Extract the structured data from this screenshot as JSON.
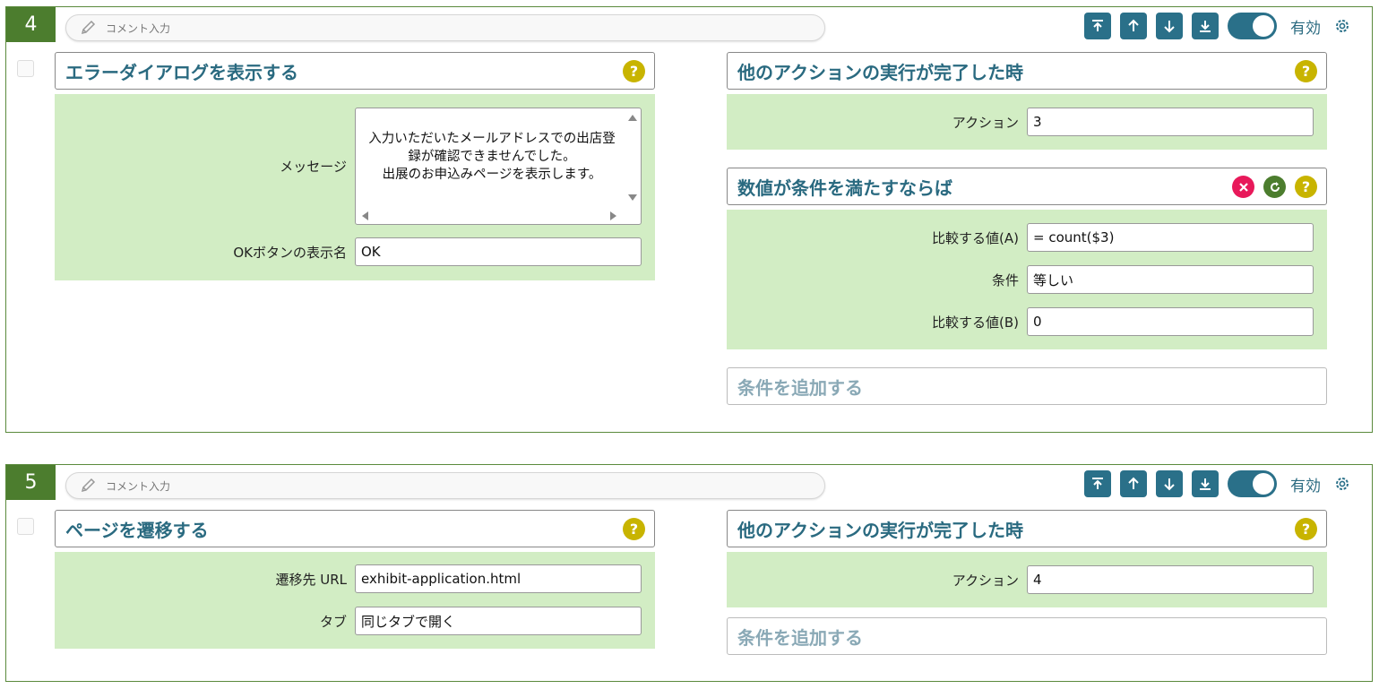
{
  "colors": {
    "accent": "#2a7089",
    "card_border": "#5a8a3c",
    "number_bg": "#4c7d2e",
    "body_bg": "#d2edc4",
    "title": "#2a6a80",
    "help": "#c8b400",
    "delete": "#e8195a",
    "reset": "#4c7d2e"
  },
  "cards": [
    {
      "number": "4",
      "comment_placeholder": "コメント入力",
      "enabled_label": "有効",
      "action": {
        "title": "エラーダイアログを表示する",
        "message_label": "メッセージ",
        "message_value": "入力いただいたメールアドレスでの出店登録が確認できませんでした。\n出展のお申込みページを表示します。",
        "message_lines": [
          "入力いただいたメールアドレスでの出店登",
          "録が確認できませんでした。",
          "出展のお申込みページを表示します。"
        ],
        "ok_label": "OKボタンの表示名",
        "ok_value": "OK"
      },
      "trigger": {
        "title": "他のアクションの実行が完了した時",
        "action_label": "アクション",
        "action_value": "3"
      },
      "condition": {
        "title": "数値が条件を満たすならば",
        "a_label": "比較する値(A)",
        "a_value": "= count($3)",
        "cond_label": "条件",
        "cond_value": "等しい",
        "b_label": "比較する値(B)",
        "b_value": "0"
      },
      "add_condition": "条件を追加する"
    },
    {
      "number": "5",
      "comment_placeholder": "コメント入力",
      "enabled_label": "有効",
      "action": {
        "title": "ページを遷移する",
        "url_label": "遷移先 URL",
        "url_value": "exhibit-application.html",
        "tab_label": "タブ",
        "tab_value": "同じタブで開く"
      },
      "trigger": {
        "title": "他のアクションの実行が完了した時",
        "action_label": "アクション",
        "action_value": "4"
      },
      "add_condition": "条件を追加する"
    }
  ],
  "icons": {
    "comment": "pencil-icon",
    "move_top": "arrow-to-top-icon",
    "move_up": "arrow-up-icon",
    "move_down": "arrow-down-icon",
    "move_bottom": "arrow-to-bottom-icon",
    "settings": "gear-icon",
    "help": "help-icon",
    "delete": "delete-icon",
    "reset": "reset-icon"
  }
}
